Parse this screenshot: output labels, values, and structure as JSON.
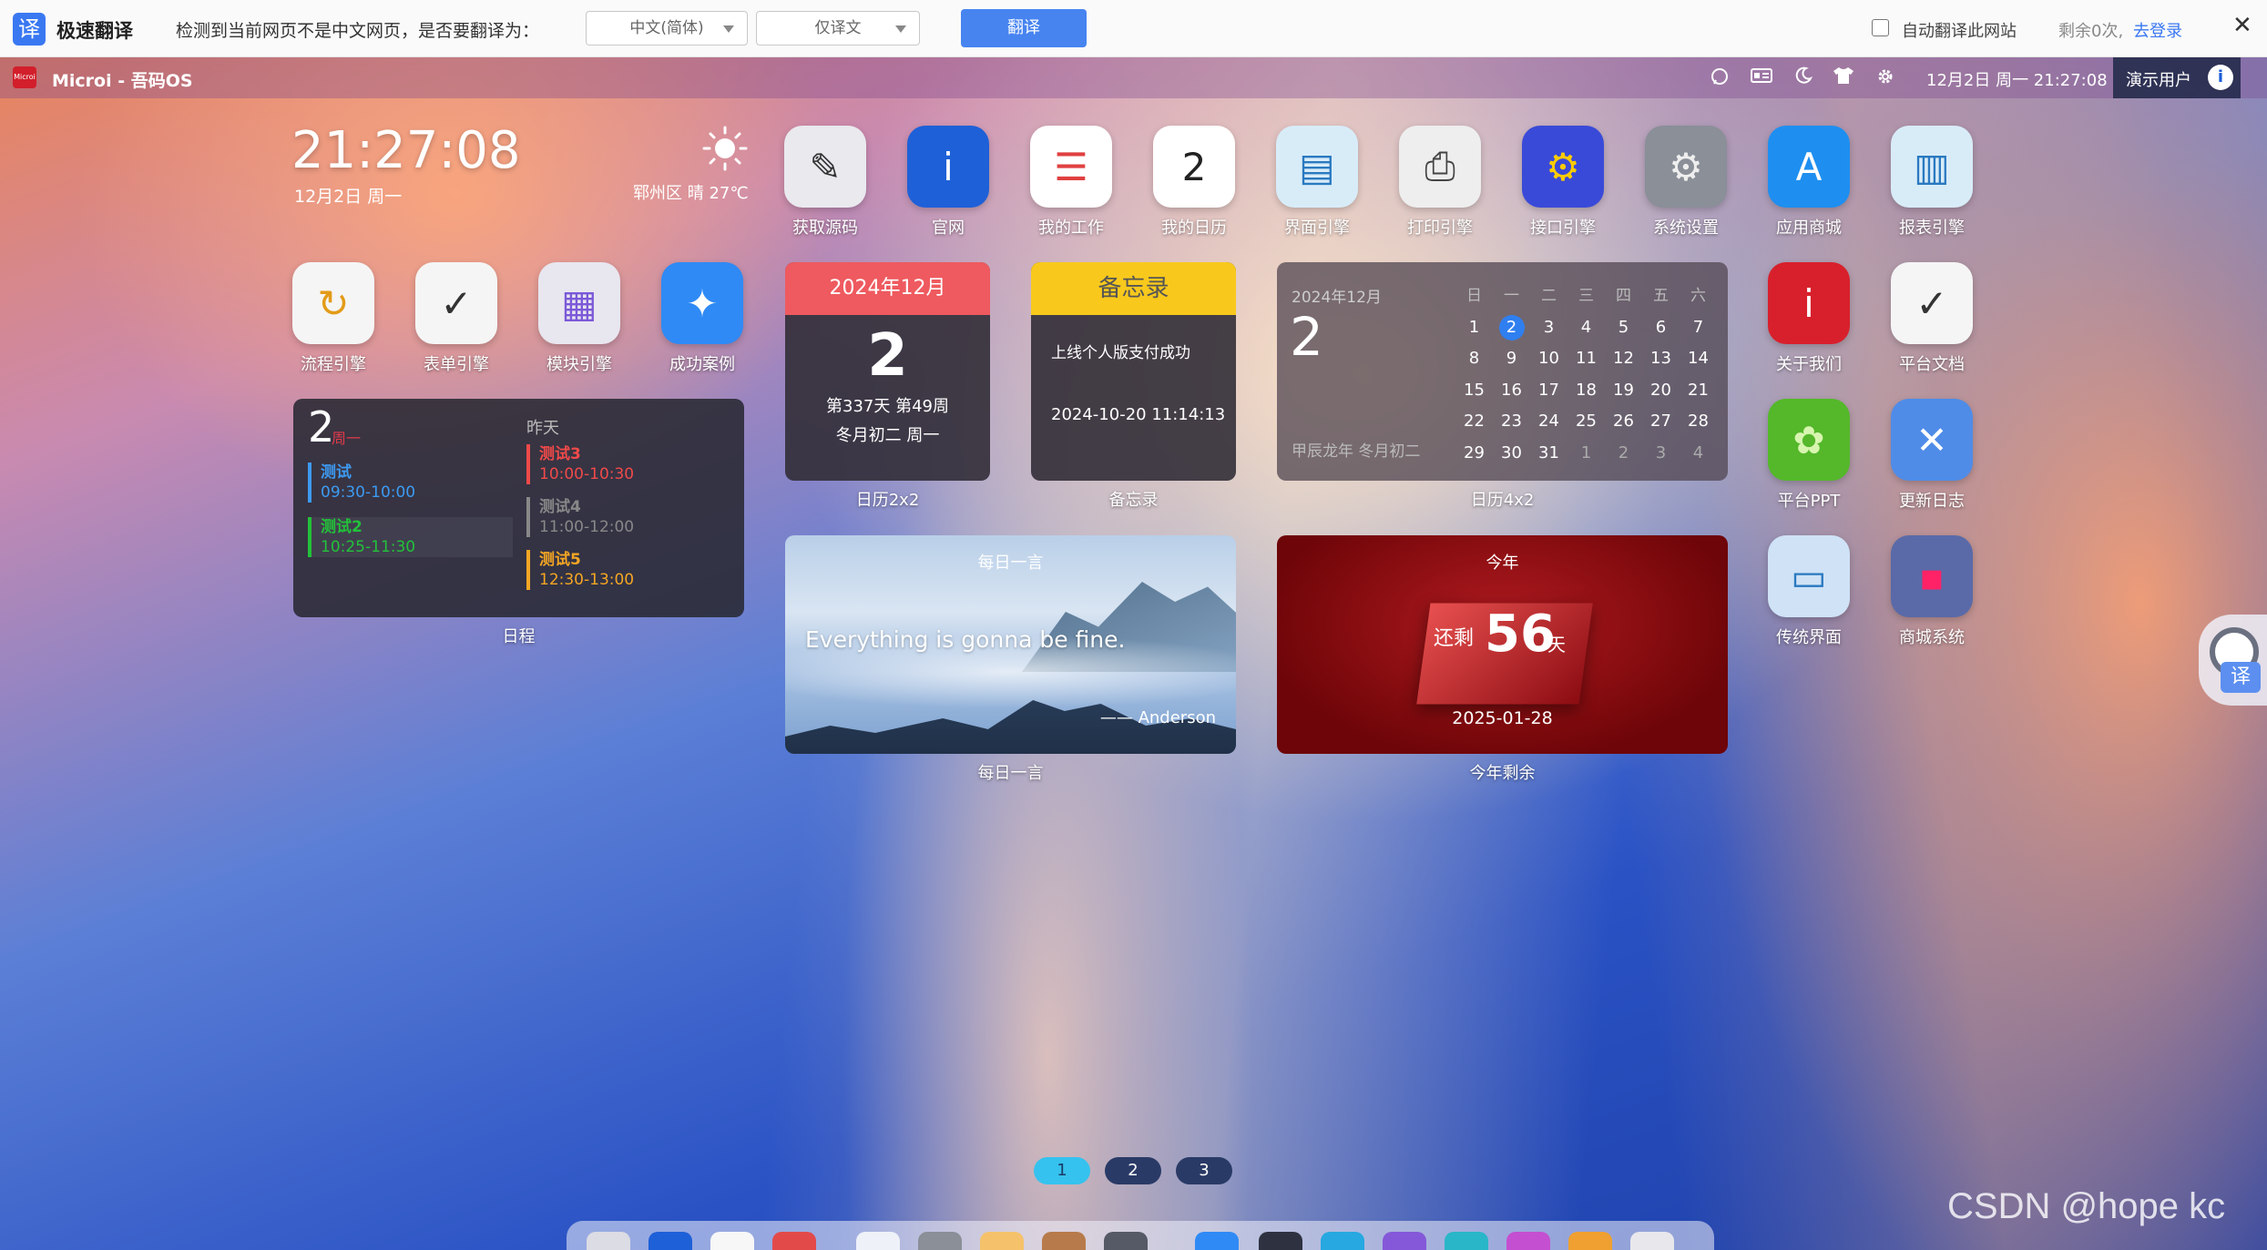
{
  "translate_bar": {
    "logo_glyph": "译",
    "name": "极速翻译",
    "message": "检测到当前网页不是中文网页，是否要翻译为：",
    "target_lang": "中文(简体)",
    "mode": "仅译文",
    "translate_button": "翻译",
    "auto_label": "自动翻译此网站",
    "remaining": "剩余0次,",
    "login": "去登录",
    "close": "✕"
  },
  "system_bar": {
    "logo_text": "Microi",
    "title": "Microi - 吾码OS",
    "datetime": "12月2日 周一 21:27:08",
    "user": "演示用户",
    "user_avatar_glyph": "i",
    "icons": [
      "chat-icon",
      "id-card-icon",
      "moon-icon",
      "shirt-icon",
      "gear-icon"
    ]
  },
  "clock": {
    "time": "21:27:08",
    "date": "12月2日 周一"
  },
  "weather": {
    "text": "郓州区 晴 27℃",
    "icon": "sun-icon"
  },
  "apps_top": [
    {
      "label": "获取源码",
      "glyph": "✎",
      "color": "#e9e9ee",
      "fg": "#333"
    },
    {
      "label": "官网",
      "glyph": "i",
      "color": "#1e60d8",
      "fg": "#fff"
    },
    {
      "label": "我的工作",
      "glyph": "☰",
      "color": "#ffffff",
      "fg": "#e04040"
    },
    {
      "label": "我的日历",
      "glyph": "2",
      "color": "#ffffff",
      "fg": "#222"
    },
    {
      "label": "界面引擎",
      "glyph": "▤",
      "color": "#d8ecf8",
      "fg": "#2a79c0"
    },
    {
      "label": "打印引擎",
      "glyph": "⎙",
      "color": "#eeeeee",
      "fg": "#444"
    },
    {
      "label": "接口引擎",
      "glyph": "⚙",
      "color": "#3a4ad8",
      "fg": "#ffcc00"
    },
    {
      "label": "系统设置",
      "glyph": "⚙",
      "color": "#8a8f98",
      "fg": "#eee"
    },
    {
      "label": "应用商城",
      "glyph": "A",
      "color": "#1e8ff0",
      "fg": "#fff"
    },
    {
      "label": "报表引擎",
      "glyph": "▥",
      "color": "#d8ecf8",
      "fg": "#2a79c0"
    }
  ],
  "apps_left": [
    {
      "label": "流程引擎",
      "glyph": "↻",
      "color": "#f5f5f5",
      "fg": "#e39b18"
    },
    {
      "label": "表单引擎",
      "glyph": "✓",
      "color": "#f5f5f5",
      "fg": "#333"
    },
    {
      "label": "模块引擎",
      "glyph": "▦",
      "color": "#e8e6ef",
      "fg": "#7b59d8"
    },
    {
      "label": "成功案例",
      "glyph": "✦",
      "color": "#2f8af5",
      "fg": "#fff"
    }
  ],
  "apps_right": [
    {
      "label": "关于我们",
      "glyph": "i",
      "color": "#d8202c",
      "fg": "#fff"
    },
    {
      "label": "平台文档",
      "glyph": "✓",
      "color": "#f5f5f5",
      "fg": "#333"
    },
    {
      "label": "平台PPT",
      "glyph": "✿",
      "color": "#54b82a",
      "fg": "#d8f5b0"
    },
    {
      "label": "更新日志",
      "glyph": "✕",
      "color": "#4f8ce8",
      "fg": "#fff"
    },
    {
      "label": "传统界面",
      "glyph": "▭",
      "color": "#cfe2f6",
      "fg": "#2a79c0"
    },
    {
      "label": "商城系统",
      "glyph": "▪",
      "color": "#5a6aa8",
      "fg": "#f26"
    }
  ],
  "schedule": {
    "day": "2",
    "weekday": "周一",
    "yesterday": "昨天",
    "label": "日程",
    "today_events": [
      {
        "title": "测试",
        "time": "09:30-10:00",
        "color": "#3d9af0"
      },
      {
        "title": "测试2",
        "time": "10:25-11:30",
        "color": "#23c13a"
      }
    ],
    "yesterday_events": [
      {
        "title": "测试3",
        "time": "10:00-10:30",
        "color": "#f04a4a"
      },
      {
        "title": "测试4",
        "time": "11:00-12:00",
        "color": "#888888"
      },
      {
        "title": "测试5",
        "time": "12:30-13:00",
        "color": "#f5a623"
      }
    ]
  },
  "cal22": {
    "header": "2024年12月",
    "day": "2",
    "line1": "第337天 第49周",
    "line2": "冬月初二 周一",
    "label": "日历2x2"
  },
  "memo": {
    "header": "备忘录",
    "item": "上线个人版支付成功",
    "time": "2024-10-20 11:14:13",
    "label": "备忘录"
  },
  "cal42": {
    "year_month": "2024年12月",
    "day": "2",
    "lunar": "甲辰龙年 冬月初二",
    "label": "日历4x2",
    "weekdays": [
      "日",
      "一",
      "二",
      "三",
      "四",
      "五",
      "六"
    ],
    "weeks": [
      [
        "1",
        "2",
        "3",
        "4",
        "5",
        "6",
        "7"
      ],
      [
        "8",
        "9",
        "10",
        "11",
        "12",
        "13",
        "14"
      ],
      [
        "15",
        "16",
        "17",
        "18",
        "19",
        "20",
        "21"
      ],
      [
        "22",
        "23",
        "24",
        "25",
        "26",
        "27",
        "28"
      ],
      [
        "29",
        "30",
        "31",
        "1",
        "2",
        "3",
        "4"
      ]
    ],
    "today": "2"
  },
  "quote": {
    "title": "每日一言",
    "text": "Everything is gonna be fine.",
    "author": "—— Anderson",
    "label": "每日一言"
  },
  "year_remain": {
    "title": "今年",
    "prefix": "还剩",
    "days": "56",
    "unit": "天",
    "date": "2025-01-28",
    "label": "今年剩余"
  },
  "pager": [
    "1",
    "2",
    "3"
  ],
  "pager_active": 0,
  "floating": {
    "glyph": "译"
  },
  "watermark": "CSDN @hope kc"
}
